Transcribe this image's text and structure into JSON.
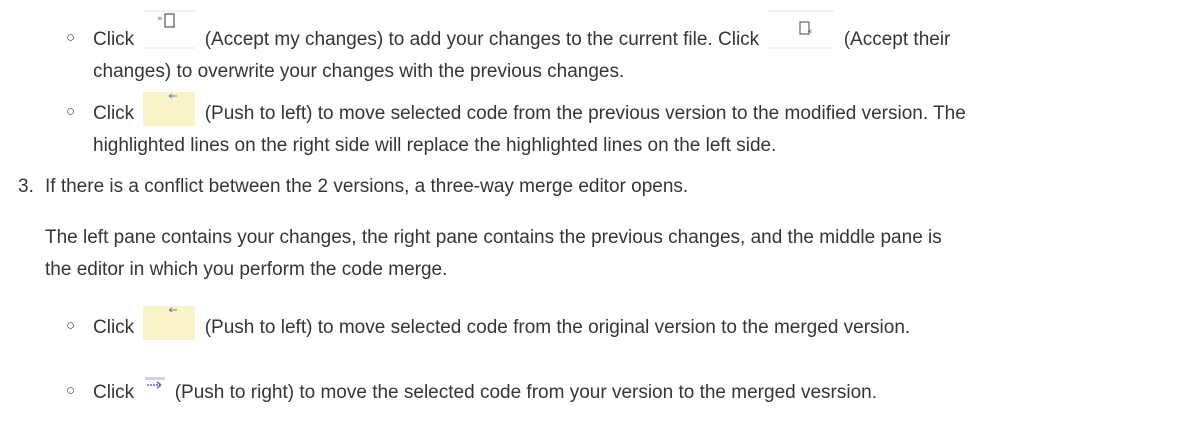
{
  "items": [
    {
      "marker": "○",
      "before_icon1": "Click",
      "icon1": "accept-my-changes-icon",
      "after_icon1": "(Accept my changes) to add your changes to the current file. Click",
      "icon2": "accept-their-changes-icon",
      "after_icon2": "(Accept their",
      "line2": "changes) to overwrite your changes with the previous changes."
    },
    {
      "marker": "○",
      "before_icon": "Click",
      "icon": "push-to-left-icon",
      "after_icon": "(Push to left) to move selected code from the previous version to the modified version. The",
      "line2": "highlighted lines on the right side will replace the highlighted lines on the left side."
    }
  ],
  "step3": {
    "number": "3.",
    "text": "If there is a conflict between the 2 versions, a three-way merge editor opens.",
    "para_line1": "The left pane contains your changes, the right pane contains the previous changes, and the middle pane is",
    "para_line2": "the editor in which you perform the code merge.",
    "sub_items": [
      {
        "marker": "○",
        "before_icon": "Click",
        "icon": "push-to-left-icon",
        "after_icon": "(Push to left) to move selected code from the original version to the merged version."
      },
      {
        "marker": "○",
        "before_icon": "Click",
        "icon": "push-to-right-icon",
        "after_icon": "(Push to right) to move the selected code from your version to the merged vesrsion."
      }
    ]
  }
}
